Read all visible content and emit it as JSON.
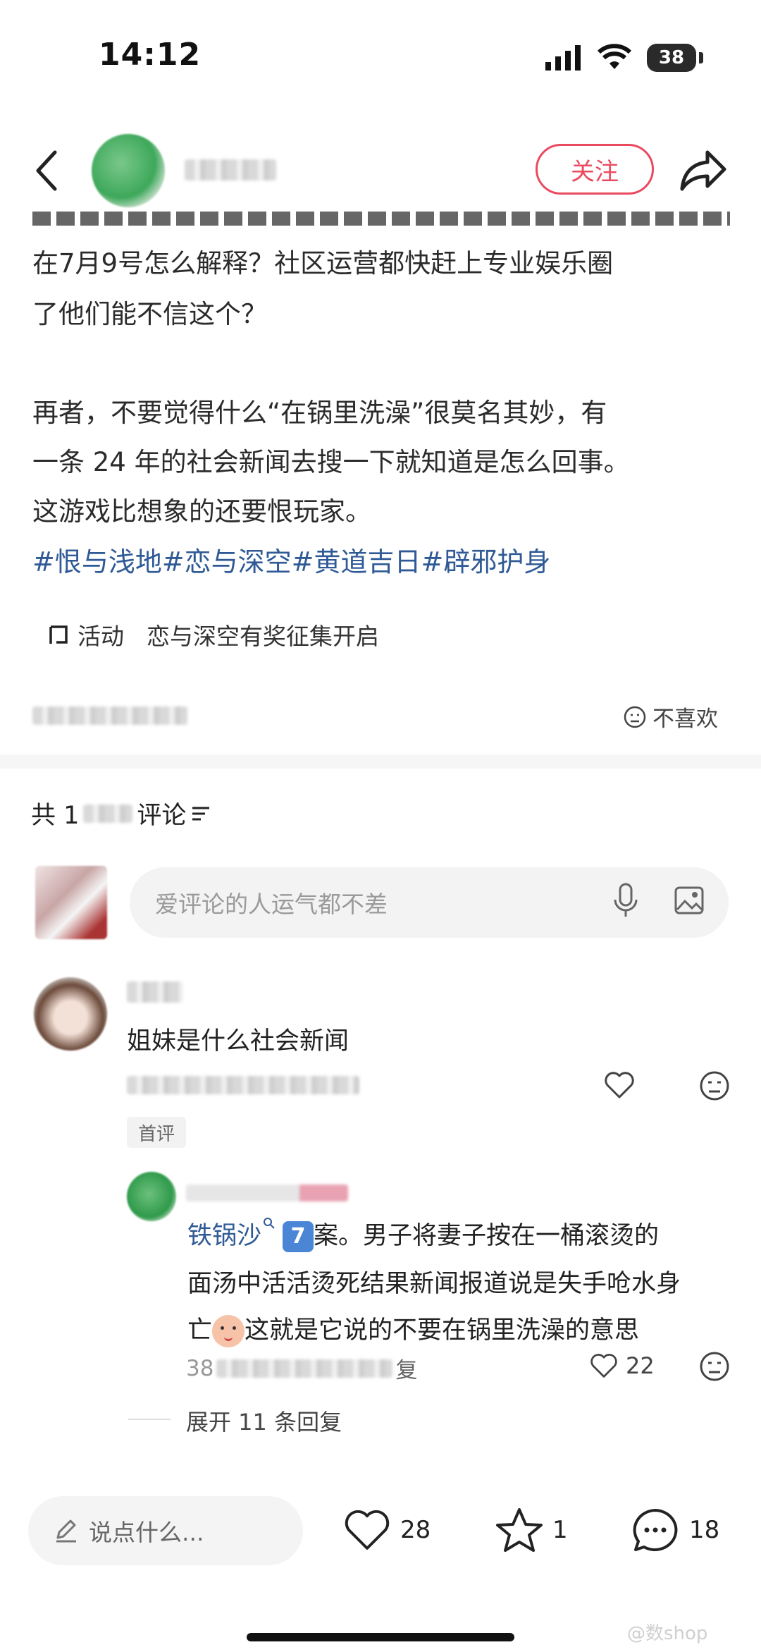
{
  "status_bar": {
    "time": "14:12",
    "battery": "38"
  },
  "header": {
    "follow_label": "关注"
  },
  "post": {
    "line1": "在7月9号怎么解释？社区运营都快赶上专业娱乐圈",
    "line2": "了他们能不信这个？",
    "line3": "再者，不要觉得什么“在锅里洗澡”很莫名其妙，有",
    "line4": "一条 24 年的社会新闻去搜一下就知道是怎么回事。",
    "line5": "这游戏比想象的还要恨玩家。",
    "tags": "#恨与浅地#恋与深空#黄道吉日#辟邪护身",
    "activity_label": "活动",
    "activity_text": "恋与深空有奖征集开启",
    "dislike_label": "不喜欢"
  },
  "comments": {
    "count_prefix": "共 1",
    "count_suffix": "评论",
    "input_placeholder": "爱评论的人运气都不差",
    "first": {
      "text": "姐妹是什么社会新闻",
      "tag": "首评"
    },
    "reply": {
      "line1_a": "铁锅沙",
      "line1_b": "案。男子将妻子按在一桶滚烫的",
      "badge": "7",
      "line2": "面汤中活活烫死结果新闻报道说是失手呛水身",
      "line3": "这就是它说的不要在锅里洗澡的意思",
      "line3_prefix": "亡",
      "time_prefix": "38",
      "reply_label": "复",
      "likes": "22"
    },
    "expand_label": "展开 11 条回复"
  },
  "bottom_bar": {
    "say_placeholder": "说点什么...",
    "likes": "28",
    "stars": "1",
    "comments": "18"
  },
  "watermark": "@数shop"
}
